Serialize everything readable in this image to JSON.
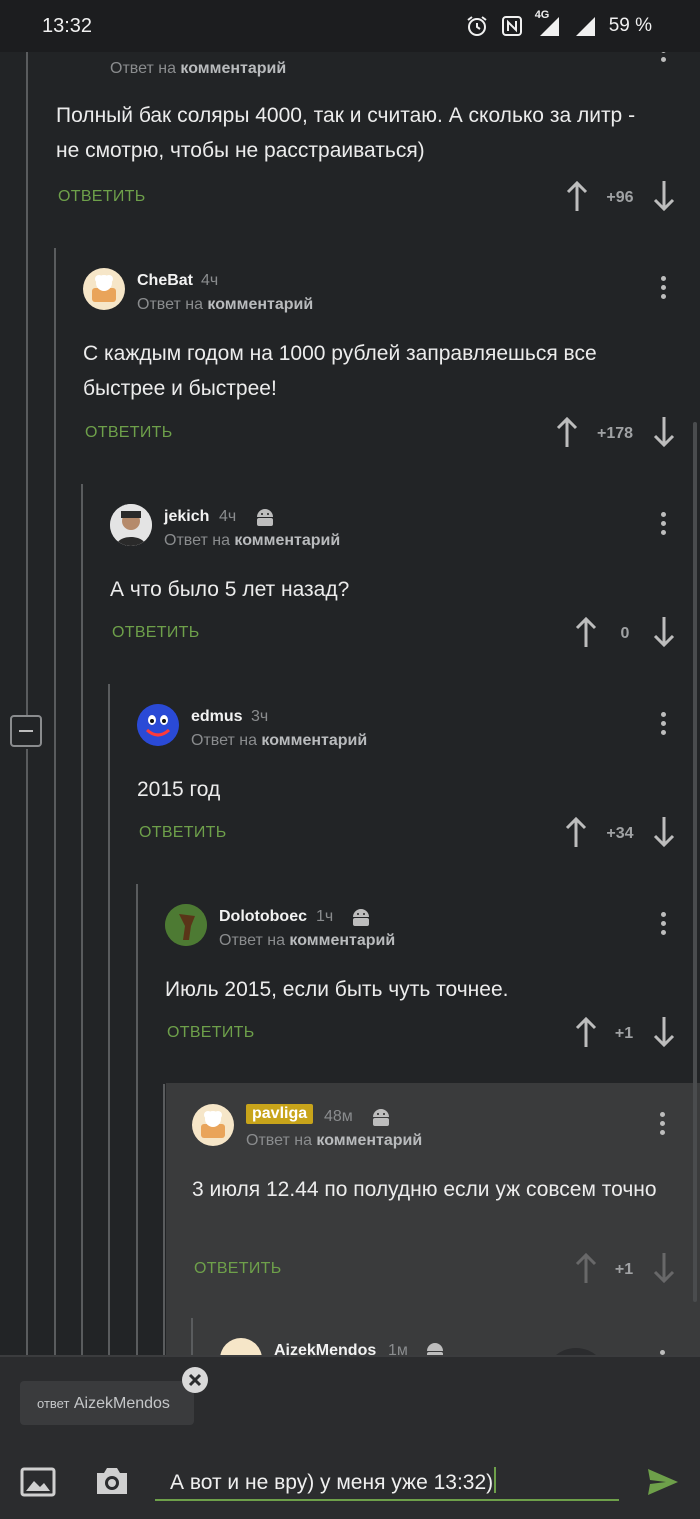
{
  "status": {
    "time": "13:32",
    "net": "4G",
    "battery": "59 %"
  },
  "labels": {
    "reply_to": "Ответ на",
    "comment": "комментарий",
    "reply": "ОТВЕТИТЬ"
  },
  "comments": [
    {
      "author": "",
      "time": "",
      "text": "Полный бак соляры 4000, так и считаю. А сколько за литр - не смотрю, чтобы не расстраиваться)",
      "score": "+96"
    },
    {
      "author": "CheBat",
      "time": "4ч",
      "text": "С каждым годом на 1000 рублей заправляешься все быстрее и быстрее!",
      "score": "+178"
    },
    {
      "author": "jekich",
      "time": "4ч",
      "text": "А что было 5 лет назад?",
      "score": "0"
    },
    {
      "author": "edmus",
      "time": "3ч",
      "text": "2015 год",
      "score": "+34"
    },
    {
      "author": "Dolotoboec",
      "time": "1ч",
      "text": "Июль 2015, если быть чуть точнее.",
      "score": "+1"
    },
    {
      "author": "pavliga",
      "time": "48м",
      "text": "3 июля 12.44 по полудню если уж совсем точно",
      "score": "+1"
    },
    {
      "author": "AizekMendos",
      "time": "1м",
      "text": "",
      "score": ""
    }
  ],
  "reply_chip": {
    "prefix": "ответ",
    "name": "AizekMendos"
  },
  "composer": {
    "text": "А вот и не вру) у меня уже 13:32)"
  },
  "colors": {
    "background": "#222426",
    "accent": "#6ea04a",
    "highlight": "#3a3b3c",
    "badge": "#c8a41a"
  }
}
